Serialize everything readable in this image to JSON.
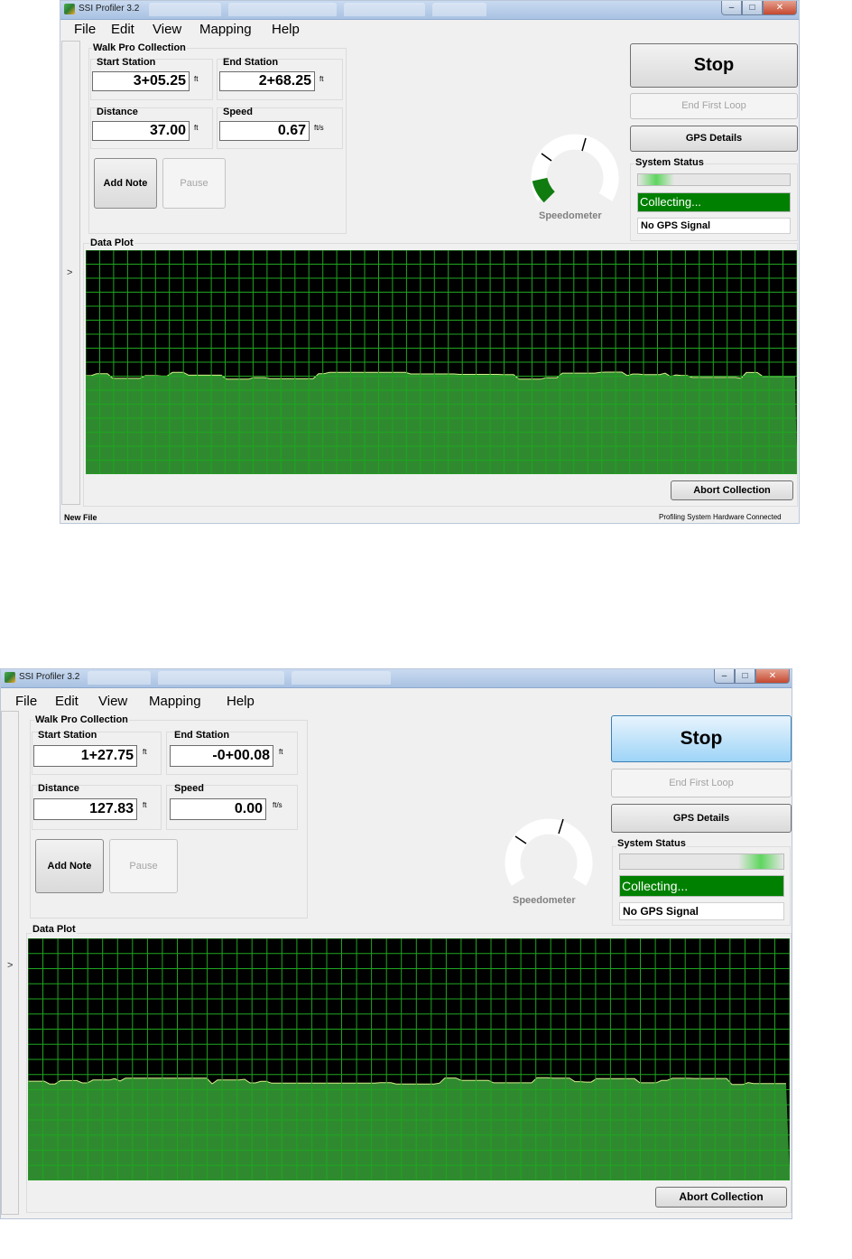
{
  "app": {
    "title": "SSI Profiler 3.2",
    "menu": [
      "File",
      "Edit",
      "View",
      "Mapping",
      "Help"
    ],
    "window_controls": {
      "minimize": "–",
      "maximize": "□",
      "close": "✕"
    }
  },
  "labels": {
    "walk_group": "Walk Pro Collection",
    "start_station": "Start Station",
    "end_station": "End Station",
    "distance": "Distance",
    "speed": "Speed",
    "unit_ft": "ft",
    "unit_fts": "ft/s",
    "add_note": "Add Note",
    "pause": "Pause",
    "stop": "Stop",
    "end_first_loop": "End First Loop",
    "gps_details": "GPS Details",
    "system_status": "System Status",
    "collecting": "Collecting...",
    "gps_signal": "No GPS Signal",
    "speedometer": "Speedometer",
    "data_plot": "Data Plot",
    "abort": "Abort Collection",
    "side_arrow": ">"
  },
  "screens": [
    {
      "start_station": "3+05.25",
      "end_station": "2+68.25",
      "distance": "37.00",
      "speed": "0.67",
      "speedometer_fill": 0.12,
      "stop_highlighted": false,
      "status_left": "New File",
      "status_right": "Profiling System Hardware Connected"
    },
    {
      "start_station": "1+27.75",
      "end_station": "-0+00.08",
      "distance": "127.83",
      "speed": "0.00",
      "speedometer_fill": 0.0,
      "stop_highlighted": true,
      "status_left": "",
      "status_right": ""
    }
  ],
  "colors": {
    "plot_bg": "#000000",
    "plot_grid": "#1fa51f",
    "plot_fill": "#2f8a2f",
    "plot_line": "#d6f08a",
    "collecting_bg": "#008000",
    "speedo_fill": "#107c10"
  },
  "icons": [
    "app-icon",
    "minimize-icon",
    "maximize-icon",
    "close-icon",
    "expand-arrow-icon"
  ]
}
